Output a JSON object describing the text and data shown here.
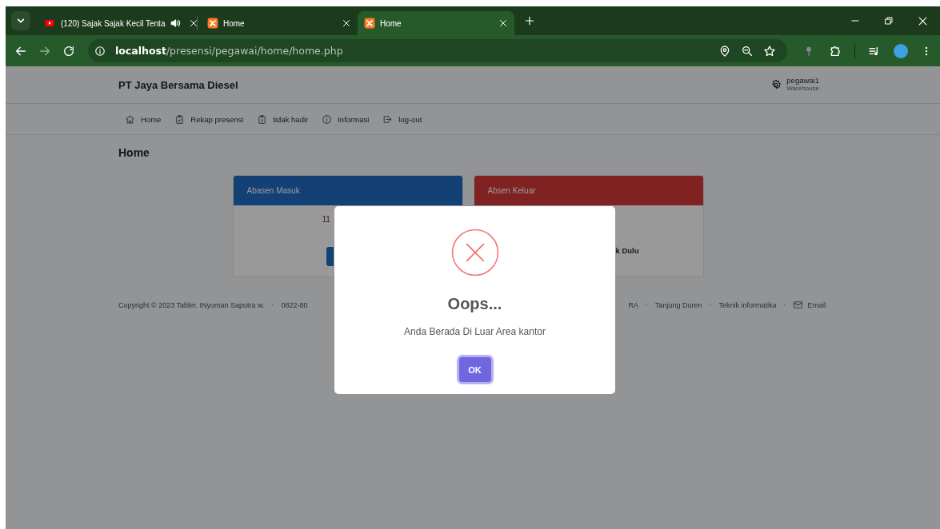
{
  "browser": {
    "tabs": [
      {
        "title": "(120) Sajak Sajak Kecil Tenta",
        "kind": "video",
        "playing_audio": true,
        "selected": false
      },
      {
        "title": "Home",
        "kind": "app",
        "playing_audio": false,
        "selected": false
      },
      {
        "title": "Home",
        "kind": "app",
        "playing_audio": false,
        "selected": true
      }
    ],
    "address": {
      "host": "localhost",
      "path": "/presensi/pegawai/home/home.php"
    }
  },
  "header": {
    "brand": "PT Jaya Bersama Diesel",
    "user": {
      "name": "pegawai1",
      "role": "Warehouse"
    }
  },
  "nav": [
    {
      "label": "Home"
    },
    {
      "label": "Rekap presensi"
    },
    {
      "label": "tidak hadir"
    },
    {
      "label": "Informasi"
    },
    {
      "label": "log-out"
    }
  ],
  "page_title": "Home",
  "cards": [
    {
      "kind": "in",
      "title": "Abasen Masuk",
      "text": "11",
      "has_button": true
    },
    {
      "kind": "out",
      "title": "Absen Keluar",
      "text": "k Dulu",
      "has_button": false
    }
  ],
  "footer": {
    "left": [
      {
        "text": "Copyright © 2023 Tabler. INyoman Saputra w."
      },
      {
        "kind": "separator",
        "text": "·"
      },
      {
        "text": "0822-80"
      }
    ],
    "right": [
      {
        "kind": "link",
        "text": "RA"
      },
      {
        "kind": "separator",
        "text": "·"
      },
      {
        "kind": "link",
        "text": "Tanjung Duren"
      },
      {
        "kind": "separator",
        "text": "·"
      },
      {
        "kind": "link",
        "text": "Teknik informatika"
      },
      {
        "kind": "separator",
        "text": "·"
      },
      {
        "kind": "email",
        "text": "Email"
      }
    ]
  },
  "dialog": {
    "kind": "error",
    "title": "Oops...",
    "message": "Anda Berada Di Luar Area kantor",
    "button": "OK"
  }
}
